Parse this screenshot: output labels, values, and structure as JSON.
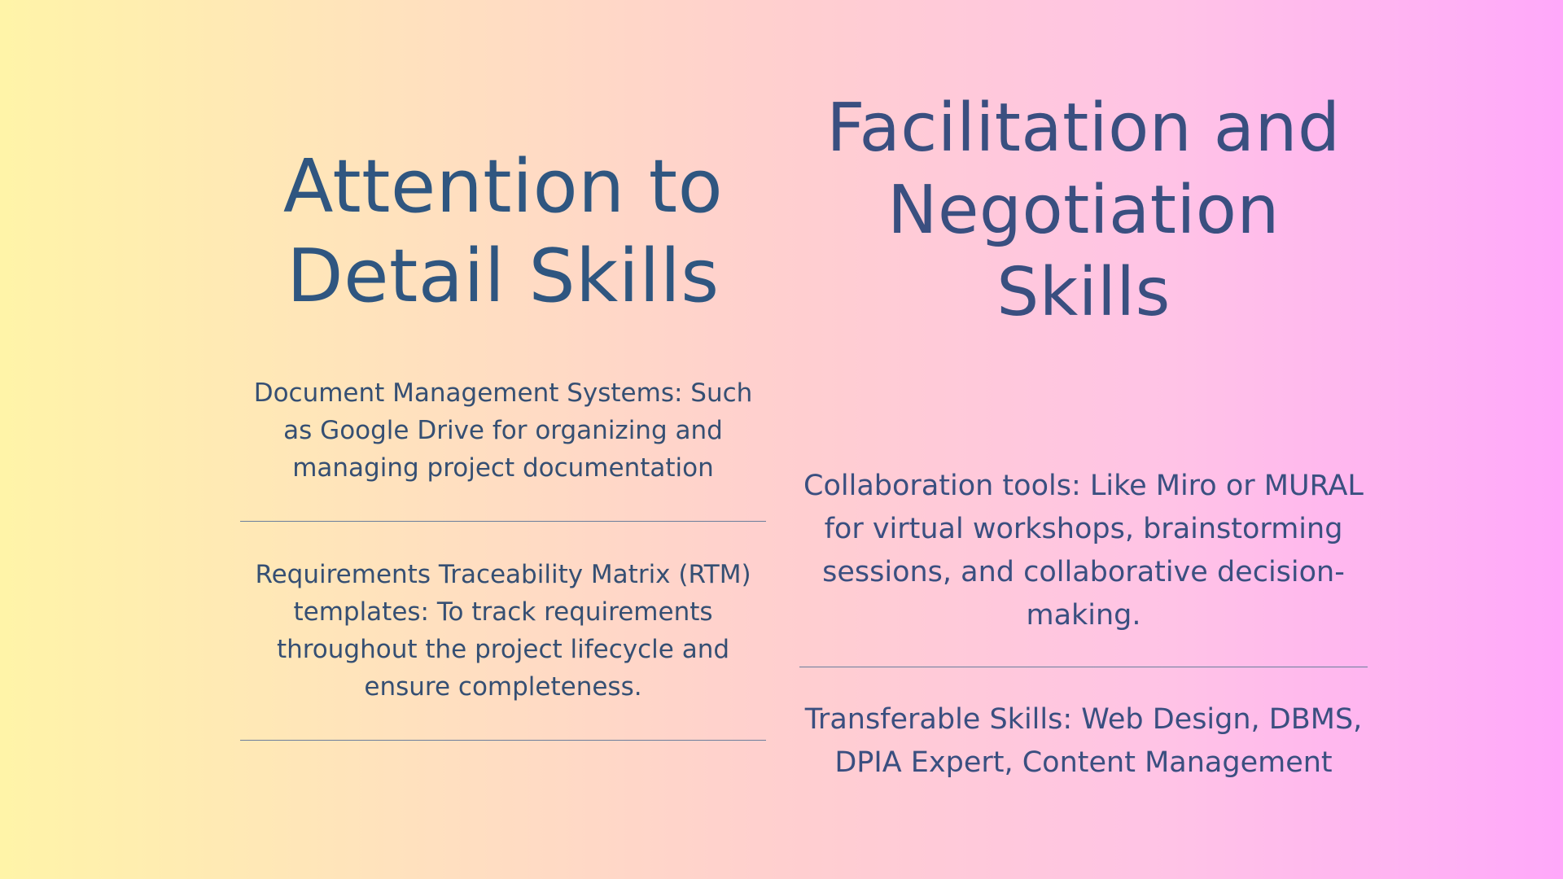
{
  "left_column": {
    "heading": "Attention to Detail Skills",
    "items": [
      "Document Management Systems: Such as Google Drive for organizing and managing project documentation",
      "Requirements Traceability Matrix (RTM) templates: To track requirements throughout the project lifecycle and ensure completeness."
    ]
  },
  "right_column": {
    "heading": "Facilitation and Negotiation Skills",
    "items": [
      "Collaboration tools: Like Miro or MURAL for virtual workshops, brainstorming sessions, and collaborative decision-making.",
      "Transferable Skills: Web Design, DBMS, DPIA Expert, Content Management"
    ]
  },
  "colors": {
    "text_primary": "#2f5680",
    "text_secondary": "#3a4f80",
    "divider": "#6a7e9c",
    "gradient_left": "#fff4a8",
    "gradient_right": "#ffa8fa"
  }
}
